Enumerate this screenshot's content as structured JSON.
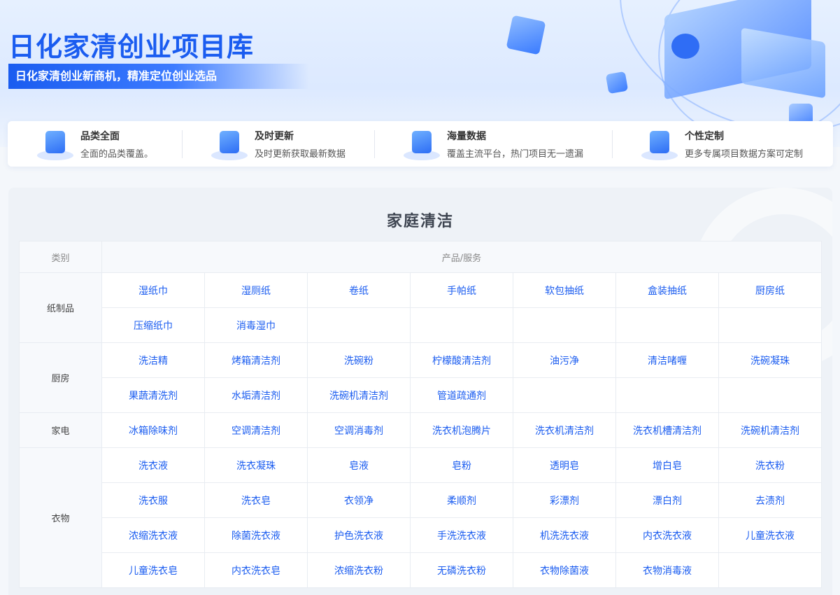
{
  "hero": {
    "title": "日化家清创业项目库",
    "subtitle": "日化家清创业新商机，精准定位创业选品"
  },
  "features": [
    {
      "icon": "folder-icon",
      "title": "品类全面",
      "desc": "全面的品类覆盖。"
    },
    {
      "icon": "update-icon",
      "title": "及时更新",
      "desc": "及时更新获取最新数据"
    },
    {
      "icon": "data-icon",
      "title": "海量数据",
      "desc": "覆盖主流平台，热门项目无一遗漏"
    },
    {
      "icon": "custom-icon",
      "title": "个性定制",
      "desc": "更多专属项目数据方案可定制"
    }
  ],
  "section": {
    "title": "家庭清洁",
    "header_category": "类别",
    "header_products": "产品/服务"
  },
  "table": [
    {
      "category": "纸制品",
      "rows": [
        [
          "湿纸巾",
          "湿厕纸",
          "卷纸",
          "手帕纸",
          "软包抽纸",
          "盒装抽纸",
          "厨房纸"
        ],
        [
          "压缩纸巾",
          "消毒湿巾",
          "",
          "",
          "",
          "",
          ""
        ]
      ]
    },
    {
      "category": "厨房",
      "rows": [
        [
          "洗洁精",
          "烤箱清洁剂",
          "洗碗粉",
          "柠檬酸清洁剂",
          "油污净",
          "清洁啫喱",
          "洗碗凝珠"
        ],
        [
          "果蔬清洗剂",
          "水垢清洁剂",
          "洗碗机清洁剂",
          "管道疏通剂",
          "",
          "",
          ""
        ]
      ]
    },
    {
      "category": "家电",
      "rows": [
        [
          "冰箱除味剂",
          "空调清洁剂",
          "空调消毒剂",
          "洗衣机泡腾片",
          "洗衣机清洁剂",
          "洗衣机槽清洁剂",
          "洗碗机清洁剂"
        ]
      ]
    },
    {
      "category": "衣物",
      "rows": [
        [
          "洗衣液",
          "洗衣凝珠",
          "皂液",
          "皂粉",
          "透明皂",
          "增白皂",
          "洗衣粉"
        ],
        [
          "洗衣服",
          "洗衣皂",
          "衣领净",
          "柔顺剂",
          "彩漂剂",
          "漂白剂",
          "去渍剂"
        ],
        [
          "浓缩洗衣液",
          "除菌洗衣液",
          "护色洗衣液",
          "手洗洗衣液",
          "机洗洗衣液",
          "内衣洗衣液",
          "儿童洗衣液"
        ],
        [
          "儿童洗衣皂",
          "内衣洗衣皂",
          "浓缩洗衣粉",
          "无磷洗衣粉",
          "衣物除菌液",
          "衣物消毒液",
          ""
        ]
      ]
    }
  ],
  "colors": {
    "accent": "#1a5cf0",
    "link": "#1a5cf0"
  }
}
